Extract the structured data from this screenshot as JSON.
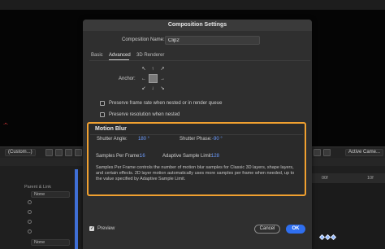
{
  "dialog": {
    "title": "Composition Settings",
    "comp_name_label": "Composition Name:",
    "comp_name_value": "Clip2",
    "tabs": [
      {
        "label": "Basic",
        "active": false
      },
      {
        "label": "Advanced",
        "active": true
      },
      {
        "label": "3D Renderer",
        "active": false
      }
    ],
    "anchor_label": "Anchor:",
    "options": [
      {
        "label": "Preserve frame rate when nested or in render queue",
        "checked": false
      },
      {
        "label": "Preserve resolution when nested",
        "checked": false
      }
    ],
    "motion_blur": {
      "title": "Motion Blur",
      "shutter_angle_label": "Shutter Angle:",
      "shutter_angle_value": "180 °",
      "shutter_phase_label": "Shutter Phase:",
      "shutter_phase_value": "-90 °",
      "samples_per_frame_label": "Samples Per Frame:",
      "samples_per_frame_value": "16",
      "adaptive_limit_label": "Adaptive Sample Limit:",
      "adaptive_limit_value": "128",
      "description": "Samples Per Frame controls the number of motion blur samples for Classic 3D layers, shape layers, and certain effects. 2D layer motion automatically uses more samples per frame when needed, up to the value specified by Adaptive Sample Limit."
    },
    "preview_label": "Preview",
    "preview_checked": true,
    "cancel_label": "Cancel",
    "ok_label": "OK"
  },
  "background": {
    "toolbar_left_select": "(Custom...)",
    "toolbar_right_select": "Active Came...",
    "parent_link_label": "Parent & Link",
    "none_label": "None",
    "ruler_time": "00f",
    "ruler_time2": "10f"
  },
  "colors": {
    "accent_blue": "#2f6ff0",
    "value_blue": "#6b9bff",
    "highlight_orange": "#f0a030"
  }
}
